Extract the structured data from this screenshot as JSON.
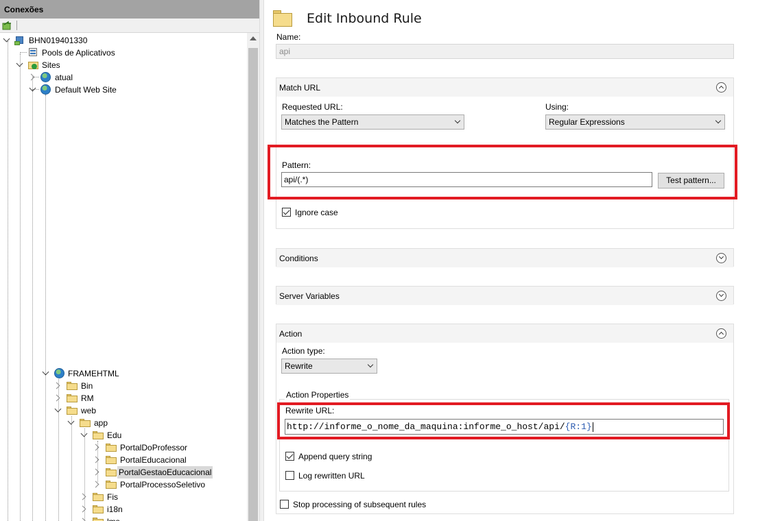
{
  "connections": {
    "title": "Conexões",
    "tree": {
      "server": "BHN019401330",
      "app_pools": "Pools de Aplicativos",
      "sites": "Sites",
      "site_atual": "atual",
      "default_web_site": "Default Web Site",
      "framehtml": "FRAMEHTML",
      "bin": "Bin",
      "rm": "RM",
      "web": "web",
      "app": "app",
      "edu": "Edu",
      "portal_do_professor": "PortalDoProfessor",
      "portal_educacional": "PortalEducacional",
      "portal_gestao_educacional": "PortalGestaoEducacional",
      "portal_processo_seletivo": "PortalProcessoSeletivo",
      "fis": "Fis",
      "i18n": "i18n",
      "lms": "lms"
    }
  },
  "editor": {
    "title": "Edit Inbound Rule",
    "name_label": "Name:",
    "name_value": "api",
    "match_url": {
      "header": "Match URL",
      "requested_url_label": "Requested URL:",
      "requested_url_value": "Matches the Pattern",
      "using_label": "Using:",
      "using_value": "Regular Expressions",
      "pattern_label": "Pattern:",
      "pattern_value": "api/(.*)",
      "test_pattern_button": "Test pattern...",
      "ignore_case_label": "Ignore case",
      "ignore_case_checked": true
    },
    "conditions": {
      "header": "Conditions"
    },
    "server_variables": {
      "header": "Server Variables"
    },
    "action": {
      "header": "Action",
      "action_type_label": "Action type:",
      "action_type_value": "Rewrite",
      "action_properties_label": "Action Properties",
      "rewrite_url_label": "Rewrite URL:",
      "rewrite_url_prefix": "http://informe_o_nome_da_maquina:informe_o_host/api/",
      "rewrite_url_backref": "{R:1}",
      "append_query_string_label": "Append query string",
      "append_query_string_checked": true,
      "log_rewritten_url_label": "Log rewritten URL",
      "log_rewritten_url_checked": false,
      "stop_processing_label": "Stop processing of subsequent rules",
      "stop_processing_checked": false
    }
  },
  "colors": {
    "highlight_red": "#e21b23",
    "panel_header_gray": "#a3a3a3",
    "section_header_bg": "#f4f4f4"
  }
}
